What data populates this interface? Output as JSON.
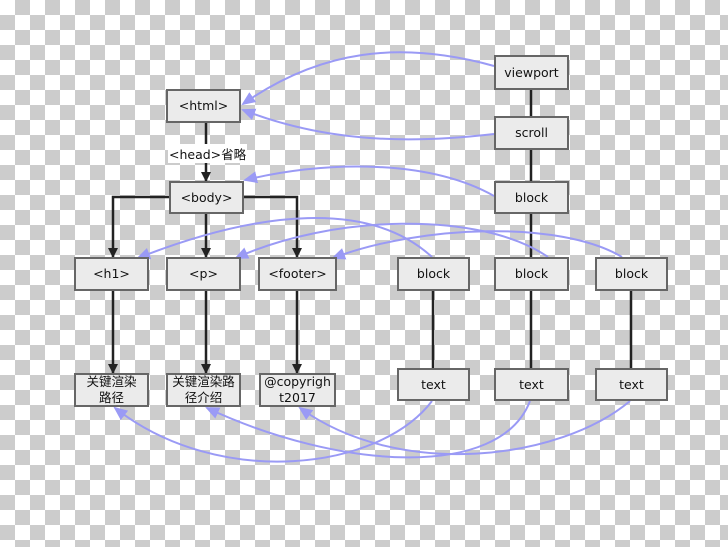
{
  "colors": {
    "node_fill": "#ebebeb",
    "node_border": "#666666",
    "tree_edge": "#111111",
    "render_edge": "#9a9af5"
  },
  "dom": {
    "html": "<html>",
    "head_label": "<head>省略",
    "body": "<body>",
    "h1": "<h1>",
    "p": "<p>",
    "footer": "<footer>",
    "h1_text": "关键渲染路径",
    "p_text": "关键渲染路径介绍",
    "footer_text": "@copyright2017"
  },
  "render": {
    "viewport": "viewport",
    "scroll": "scroll",
    "block_root": "block",
    "block_1": "block",
    "block_2": "block",
    "block_3": "block",
    "text_1": "text",
    "text_2": "text",
    "text_3": "text"
  }
}
